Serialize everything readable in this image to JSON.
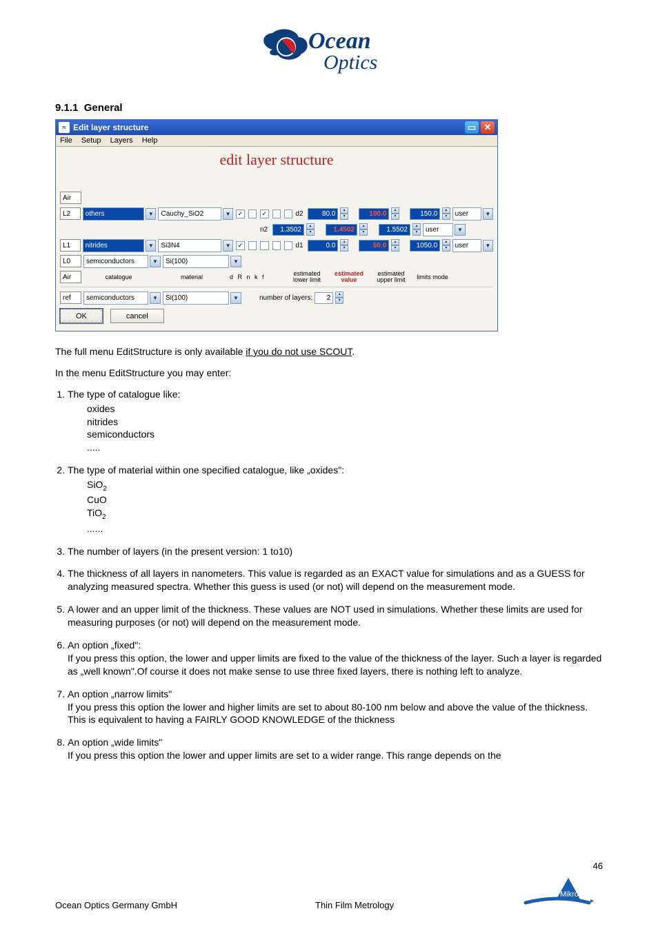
{
  "logo": {
    "brand_line1": "Ocean",
    "brand_line2": "Optics"
  },
  "section": {
    "number": "9.1.1",
    "title": "General"
  },
  "window": {
    "title": "Edit layer structure",
    "menu": [
      "File",
      "Setup",
      "Layers",
      "Help"
    ],
    "subtitle": "edit layer structure",
    "number_of_layers_label": "number of layers:",
    "number_of_layers_value": "2",
    "ok": "OK",
    "cancel": "cancel",
    "col_headers": {
      "catalogue": "catalogue",
      "material": "material",
      "flags": "d   R    n    k    f",
      "lower": "estimated lower limit",
      "value": "estimated value",
      "upper": "estimated upper limit",
      "mode": "limits mode"
    },
    "air_top": {
      "label": "Air"
    },
    "rows": [
      {
        "label": "L2",
        "catalogue": "others",
        "material": "Cauchy_SiO2",
        "flags": {
          "d": true,
          "R": false,
          "n": true,
          "k": false,
          "f": false
        },
        "param": "d2",
        "lower": "80.0",
        "value": "100.0",
        "upper": "150.0",
        "mode": "user",
        "extra": {
          "param": "n2",
          "lower": "1.3502",
          "value": "1.4502",
          "upper": "1.5502",
          "mode": "user"
        }
      },
      {
        "label": "L1",
        "catalogue": "nitrides",
        "material": "Si3N4",
        "flags": {
          "d": true,
          "R": false,
          "n": false,
          "k": false,
          "f": false
        },
        "param": "d1",
        "lower": "0.0",
        "value": "50.0",
        "upper": "1050.0",
        "mode": "user"
      },
      {
        "label": "L0",
        "catalogue": "semiconductors",
        "material": "Si(100)"
      }
    ],
    "air_bottom": {
      "label": "Air"
    },
    "ref": {
      "label": "ref",
      "catalogue": "semiconductors",
      "material": "Si(100)"
    }
  },
  "body": {
    "p1a": "The full menu EditStructure is only available ",
    "p1b": "if you do not use SCOUT",
    "p1c": ".",
    "p2": "In the menu EditStructure you may enter:",
    "li1": "The type of catalogue like:",
    "li1_items": [
      "oxides",
      "nitrides",
      "semiconductors",
      "....."
    ],
    "li2": "The type of material within one specified catalogue, like „oxides\":",
    "li2_items": [
      "SiO",
      "CuO",
      "TiO",
      "......"
    ],
    "li2_sub": "2",
    "li3": "The number of layers (in the present version: 1 to10)",
    "li4": "The thickness of all layers in nanometers. This value is regarded as an EXACT value for simulations and as a GUESS for analyzing measured spectra. Whether this guess is used (or not) will depend on the measurement mode.",
    "li5": "A lower and an upper limit of the thickness. These values are NOT used in simulations. Whether these limits are used for measuring purposes (or not) will depend on the measurement mode.",
    "li6_t": "An option „fixed\":",
    "li6_b": "If you press this option, the lower and upper limits are fixed to the value of the thickness of the layer. Such a layer is regarded as „well known\".Of course it does not make sense to use three fixed layers, there is nothing left to analyze.",
    "li7_t": "An option „narrow limits\"",
    "li7_b": "If you press this option the lower and higher limits are set to about 80-100 nm below and above the value of the thickness. This is equivalent to having a FAIRLY GOOD KNOWLEDGE of the thickness",
    "li8_t": "An option „wide limits\"",
    "li8_b": "If you press this option the lower and upper limits are set to a wider range. This range depends on the"
  },
  "footer": {
    "left": "Ocean Optics Germany GmbH",
    "mid": "Thin Film Metrology",
    "page": "46",
    "logo": "Mikropack"
  }
}
